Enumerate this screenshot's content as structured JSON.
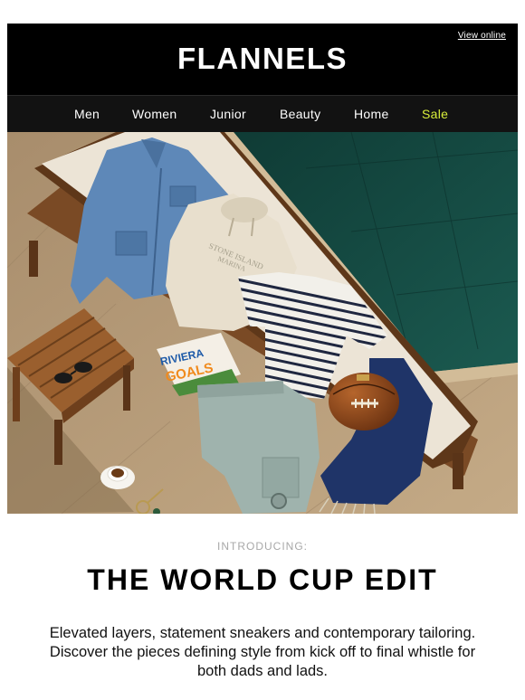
{
  "header": {
    "view_online": "View online",
    "brand": "FLANNELS"
  },
  "nav": {
    "items": [
      "Men",
      "Women",
      "Junior",
      "Beauty",
      "Home",
      "Sale"
    ],
    "sale_color": "#d9ef3b"
  },
  "hero": {
    "magazine_line1": "RIVIERA",
    "magazine_line2": "GOALS",
    "hoodie_print_line1": "STONE ISLAND",
    "hoodie_print_line2": "MARINA"
  },
  "content": {
    "eyebrow": "INTRODUCING:",
    "headline": "THE WORLD CUP EDIT",
    "body": "Elevated layers, statement sneakers and contemporary tailoring. Discover the pieces defining style from kick off to final whistle for both dads and lads."
  },
  "colors": {
    "header_bg": "#000000",
    "nav_bg": "#121212",
    "accent_sale": "#d9ef3b",
    "pool": "#14463f",
    "stone": "#b59a77"
  }
}
